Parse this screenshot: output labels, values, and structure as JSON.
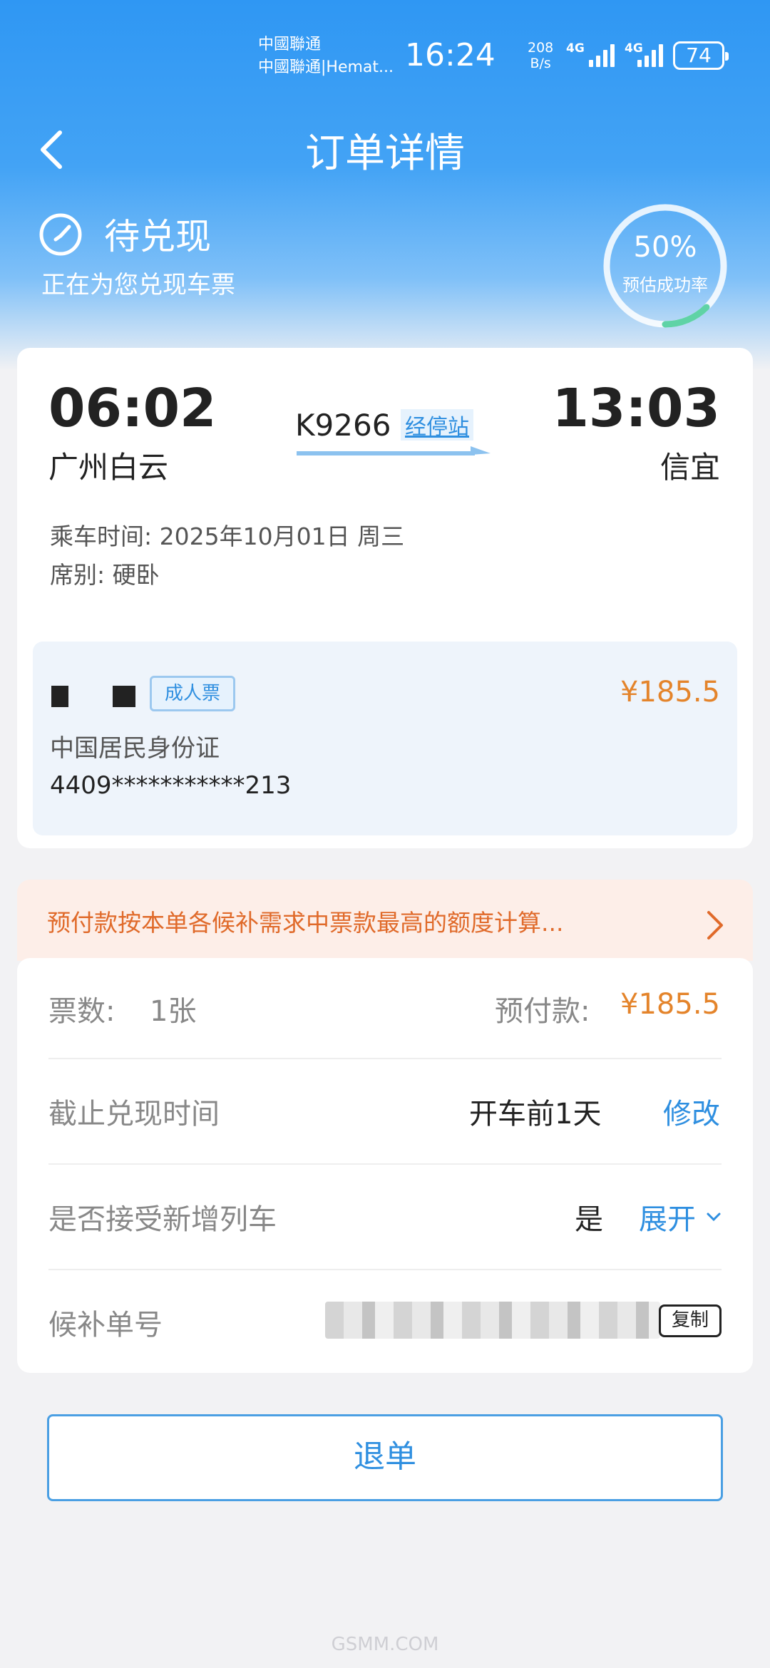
{
  "status_bar": {
    "carrier1": "中國聯通",
    "carrier2": "中國聯通|Hemat...",
    "time": "16:24",
    "speed_value": "208",
    "speed_unit": "B/s",
    "net1": "4G",
    "net2": "4G",
    "battery": "74"
  },
  "nav": {
    "title": "订单详情"
  },
  "status": {
    "state": "待兑现",
    "subtitle": "正在为您兑现车票",
    "success_pct": "50%",
    "success_label": "预估成功率",
    "success_fraction": 0.5
  },
  "trip": {
    "dep_time": "06:02",
    "dep_station": "广州白云",
    "arr_time": "13:03",
    "arr_station": "信宜",
    "train_no": "K9266",
    "stops_link": "经停站",
    "date_line": "乘车时间: 2025年10月01日 周三",
    "seat_line": "席别: 硬卧"
  },
  "passenger": {
    "ticket_type": "成人票",
    "price": "¥185.5",
    "id_type": "中国居民身份证",
    "id_no": "4409***********213"
  },
  "notice": {
    "text": "预付款按本单各候补需求中票款最高的额度计算..."
  },
  "details": {
    "count_label": "票数:",
    "count_value": "1张",
    "prepay_label": "预付款:",
    "prepay_value": "¥185.5",
    "deadline_label": "截止兑现时间",
    "deadline_value": "开车前1天",
    "deadline_action": "修改",
    "accept_label": "是否接受新增列车",
    "accept_value": "是",
    "accept_action": "展开",
    "order_label": "候补单号",
    "copy_label": "复制"
  },
  "actions": {
    "refund": "退单"
  },
  "watermark": "GSMM.COM",
  "colors": {
    "primary_blue": "#2f8fe0",
    "price_orange": "#e4842b",
    "header_blue": "#2f97f3"
  }
}
